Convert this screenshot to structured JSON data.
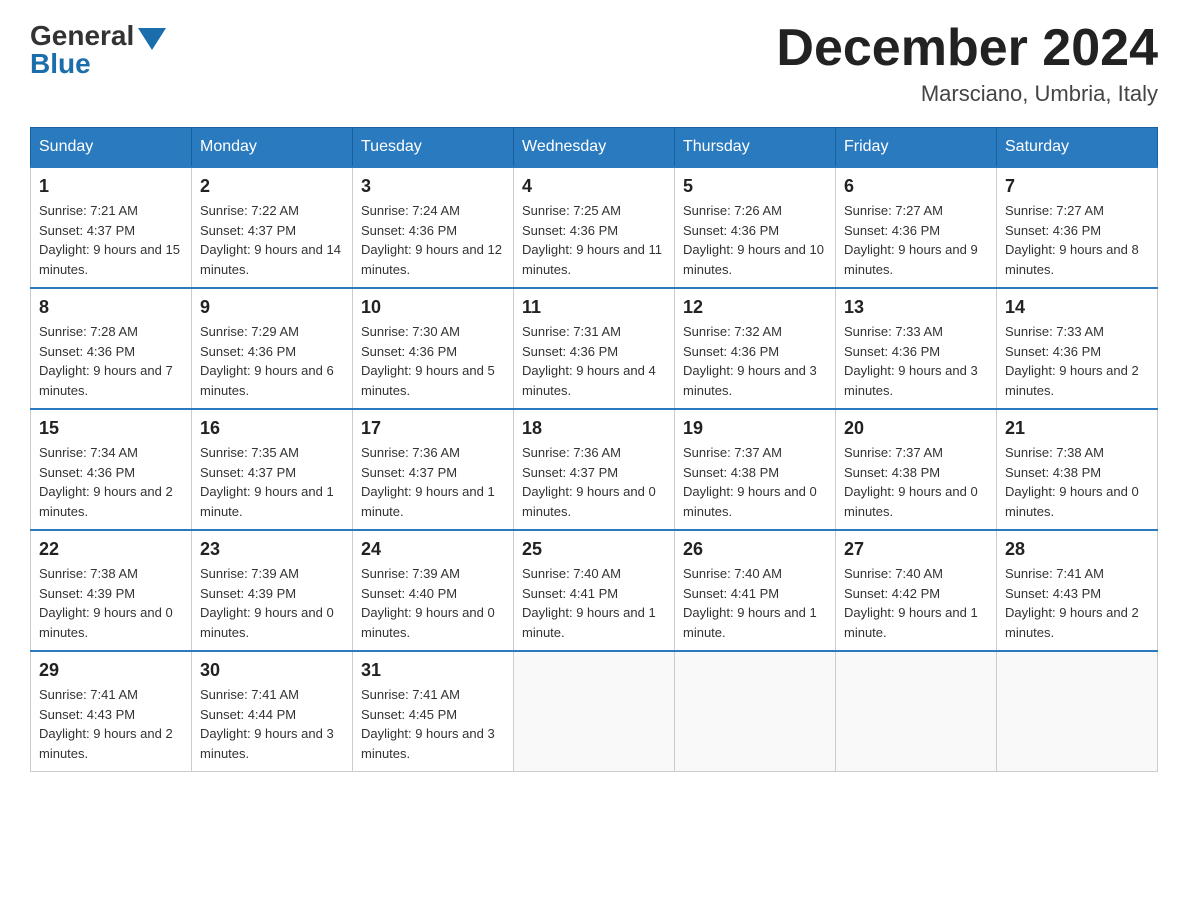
{
  "header": {
    "logo_general": "General",
    "logo_blue": "Blue",
    "month_title": "December 2024",
    "location": "Marsciano, Umbria, Italy"
  },
  "days_of_week": [
    "Sunday",
    "Monday",
    "Tuesday",
    "Wednesday",
    "Thursday",
    "Friday",
    "Saturday"
  ],
  "weeks": [
    [
      {
        "day": "1",
        "sunrise": "7:21 AM",
        "sunset": "4:37 PM",
        "daylight": "9 hours and 15 minutes."
      },
      {
        "day": "2",
        "sunrise": "7:22 AM",
        "sunset": "4:37 PM",
        "daylight": "9 hours and 14 minutes."
      },
      {
        "day": "3",
        "sunrise": "7:24 AM",
        "sunset": "4:36 PM",
        "daylight": "9 hours and 12 minutes."
      },
      {
        "day": "4",
        "sunrise": "7:25 AM",
        "sunset": "4:36 PM",
        "daylight": "9 hours and 11 minutes."
      },
      {
        "day": "5",
        "sunrise": "7:26 AM",
        "sunset": "4:36 PM",
        "daylight": "9 hours and 10 minutes."
      },
      {
        "day": "6",
        "sunrise": "7:27 AM",
        "sunset": "4:36 PM",
        "daylight": "9 hours and 9 minutes."
      },
      {
        "day": "7",
        "sunrise": "7:27 AM",
        "sunset": "4:36 PM",
        "daylight": "9 hours and 8 minutes."
      }
    ],
    [
      {
        "day": "8",
        "sunrise": "7:28 AM",
        "sunset": "4:36 PM",
        "daylight": "9 hours and 7 minutes."
      },
      {
        "day": "9",
        "sunrise": "7:29 AM",
        "sunset": "4:36 PM",
        "daylight": "9 hours and 6 minutes."
      },
      {
        "day": "10",
        "sunrise": "7:30 AM",
        "sunset": "4:36 PM",
        "daylight": "9 hours and 5 minutes."
      },
      {
        "day": "11",
        "sunrise": "7:31 AM",
        "sunset": "4:36 PM",
        "daylight": "9 hours and 4 minutes."
      },
      {
        "day": "12",
        "sunrise": "7:32 AM",
        "sunset": "4:36 PM",
        "daylight": "9 hours and 3 minutes."
      },
      {
        "day": "13",
        "sunrise": "7:33 AM",
        "sunset": "4:36 PM",
        "daylight": "9 hours and 3 minutes."
      },
      {
        "day": "14",
        "sunrise": "7:33 AM",
        "sunset": "4:36 PM",
        "daylight": "9 hours and 2 minutes."
      }
    ],
    [
      {
        "day": "15",
        "sunrise": "7:34 AM",
        "sunset": "4:36 PM",
        "daylight": "9 hours and 2 minutes."
      },
      {
        "day": "16",
        "sunrise": "7:35 AM",
        "sunset": "4:37 PM",
        "daylight": "9 hours and 1 minute."
      },
      {
        "day": "17",
        "sunrise": "7:36 AM",
        "sunset": "4:37 PM",
        "daylight": "9 hours and 1 minute."
      },
      {
        "day": "18",
        "sunrise": "7:36 AM",
        "sunset": "4:37 PM",
        "daylight": "9 hours and 0 minutes."
      },
      {
        "day": "19",
        "sunrise": "7:37 AM",
        "sunset": "4:38 PM",
        "daylight": "9 hours and 0 minutes."
      },
      {
        "day": "20",
        "sunrise": "7:37 AM",
        "sunset": "4:38 PM",
        "daylight": "9 hours and 0 minutes."
      },
      {
        "day": "21",
        "sunrise": "7:38 AM",
        "sunset": "4:38 PM",
        "daylight": "9 hours and 0 minutes."
      }
    ],
    [
      {
        "day": "22",
        "sunrise": "7:38 AM",
        "sunset": "4:39 PM",
        "daylight": "9 hours and 0 minutes."
      },
      {
        "day": "23",
        "sunrise": "7:39 AM",
        "sunset": "4:39 PM",
        "daylight": "9 hours and 0 minutes."
      },
      {
        "day": "24",
        "sunrise": "7:39 AM",
        "sunset": "4:40 PM",
        "daylight": "9 hours and 0 minutes."
      },
      {
        "day": "25",
        "sunrise": "7:40 AM",
        "sunset": "4:41 PM",
        "daylight": "9 hours and 1 minute."
      },
      {
        "day": "26",
        "sunrise": "7:40 AM",
        "sunset": "4:41 PM",
        "daylight": "9 hours and 1 minute."
      },
      {
        "day": "27",
        "sunrise": "7:40 AM",
        "sunset": "4:42 PM",
        "daylight": "9 hours and 1 minute."
      },
      {
        "day": "28",
        "sunrise": "7:41 AM",
        "sunset": "4:43 PM",
        "daylight": "9 hours and 2 minutes."
      }
    ],
    [
      {
        "day": "29",
        "sunrise": "7:41 AM",
        "sunset": "4:43 PM",
        "daylight": "9 hours and 2 minutes."
      },
      {
        "day": "30",
        "sunrise": "7:41 AM",
        "sunset": "4:44 PM",
        "daylight": "9 hours and 3 minutes."
      },
      {
        "day": "31",
        "sunrise": "7:41 AM",
        "sunset": "4:45 PM",
        "daylight": "9 hours and 3 minutes."
      },
      null,
      null,
      null,
      null
    ]
  ]
}
